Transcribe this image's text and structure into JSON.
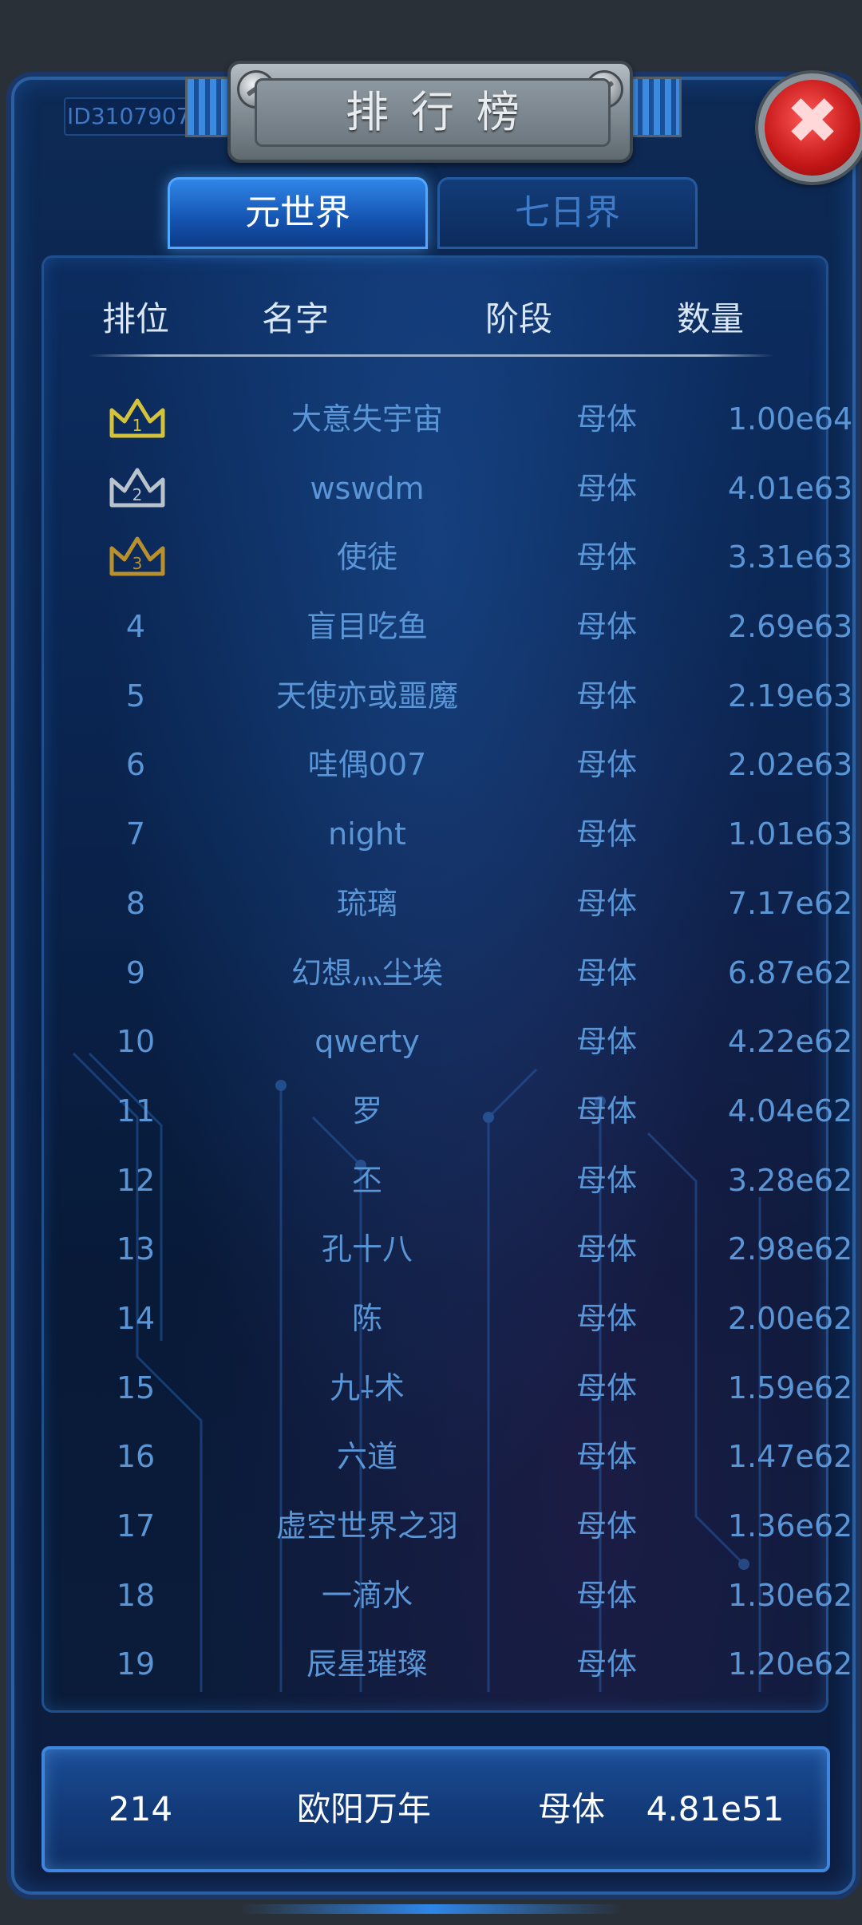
{
  "header": {
    "title": "排行榜",
    "player_id": "ID3107907",
    "close_icon": "close-icon",
    "colors": {
      "accent": "#2f86e8",
      "rank_text": "#5a95d6",
      "close": "#c41616"
    }
  },
  "tabs": [
    {
      "label": "元世界",
      "active": true
    },
    {
      "label": "七日界",
      "active": false
    }
  ],
  "columns": {
    "rank": "排位",
    "name": "名字",
    "stage": "阶段",
    "amount": "数量"
  },
  "rows": [
    {
      "rank": "1",
      "name": "大意失宇宙",
      "stage": "母体",
      "amount": "1.00e64",
      "icon": "gold-crown-icon"
    },
    {
      "rank": "2",
      "name": "wswdm",
      "stage": "母体",
      "amount": "4.01e63",
      "icon": "silver-crown-icon"
    },
    {
      "rank": "3",
      "name": "使徒",
      "stage": "母体",
      "amount": "3.31e63",
      "icon": "bronze-crown-icon"
    },
    {
      "rank": "4",
      "name": "盲目吃鱼",
      "stage": "母体",
      "amount": "2.69e63"
    },
    {
      "rank": "5",
      "name": "天使亦或噩魔",
      "stage": "母体",
      "amount": "2.19e63"
    },
    {
      "rank": "6",
      "name": "哇偶007",
      "stage": "母体",
      "amount": "2.02e63"
    },
    {
      "rank": "7",
      "name": "night",
      "stage": "母体",
      "amount": "1.01e63"
    },
    {
      "rank": "8",
      "name": "琉璃",
      "stage": "母体",
      "amount": "7.17e62"
    },
    {
      "rank": "9",
      "name": "幻想灬尘埃",
      "stage": "母体",
      "amount": "6.87e62"
    },
    {
      "rank": "10",
      "name": "qwerty",
      "stage": "母体",
      "amount": "4.22e62"
    },
    {
      "rank": "11",
      "name": "罗",
      "stage": "母体",
      "amount": "4.04e62"
    },
    {
      "rank": "12",
      "name": "丕",
      "stage": "母体",
      "amount": "3.28e62"
    },
    {
      "rank": "13",
      "name": "孔十八",
      "stage": "母体",
      "amount": "2.98e62"
    },
    {
      "rank": "14",
      "name": "陈",
      "stage": "母体",
      "amount": "2.00e62"
    },
    {
      "rank": "15",
      "name": "九⸸术",
      "stage": "母体",
      "amount": "1.59e62"
    },
    {
      "rank": "16",
      "name": "六道",
      "stage": "母体",
      "amount": "1.47e62"
    },
    {
      "rank": "17",
      "name": "虚空世界之羽",
      "stage": "母体",
      "amount": "1.36e62"
    },
    {
      "rank": "18",
      "name": "一滴水",
      "stage": "母体",
      "amount": "1.30e62"
    },
    {
      "rank": "19",
      "name": "辰星璀璨",
      "stage": "母体",
      "amount": "1.20e62"
    }
  ],
  "my_rank": {
    "rank": "214",
    "name": "欧阳万年",
    "stage": "母体",
    "amount": "4.81e51"
  }
}
